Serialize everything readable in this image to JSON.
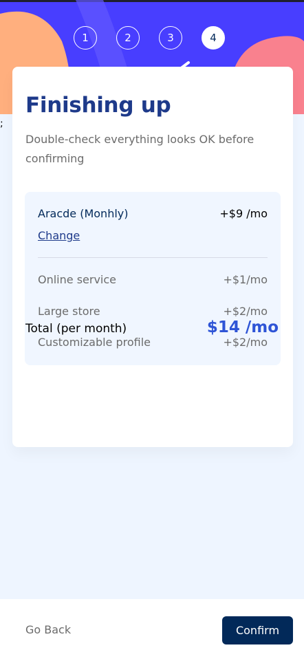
{
  "steps": [
    "1",
    "2",
    "3",
    "4"
  ],
  "active_step": 4,
  "stray_text": ";",
  "page": {
    "title": "Finishing up",
    "subtitle": "Double-check everything looks OK before confirming"
  },
  "summary": {
    "plan_name": "Aracde (Monhly)",
    "plan_price": "+$9 /mo",
    "change_label": "Change",
    "addons": [
      {
        "name": "Online service",
        "price": "+$1/mo"
      },
      {
        "name": "Large store",
        "price": "+$2/mo"
      },
      {
        "name": "Customizable profile",
        "price": "+$2/mo"
      }
    ]
  },
  "total": {
    "label": "Total (per month)",
    "value": "$14 /mo"
  },
  "footer": {
    "back_label": "Go Back",
    "confirm_label": "Confirm"
  },
  "colors": {
    "header_bg": "#483eff",
    "marine_blue": "#022959",
    "purplish_blue": "#2e54d6",
    "page_bg": "#eef5ff",
    "blob_orange": "#ffaf7e",
    "blob_pink": "#f9818e"
  }
}
